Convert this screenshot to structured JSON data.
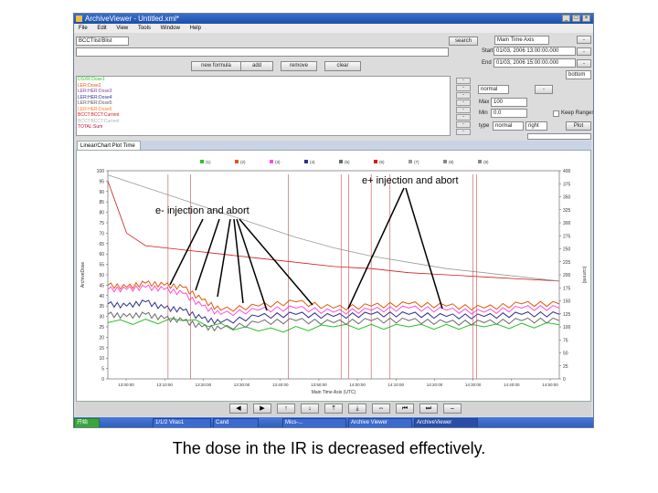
{
  "window": {
    "title": "ArchiveViewer - Untitled.xml*",
    "controls": [
      "_",
      "□",
      "×"
    ]
  },
  "menu": [
    "File",
    "Edit",
    "View",
    "Tools",
    "Window",
    "Help"
  ],
  "toolbar": {
    "pv_filter": "BCCTlist/Blist",
    "search_label": "search",
    "time_mode": "Main Time Axis",
    "start_label": "Start",
    "start_value": "01/03, 2006 13:00:00.000",
    "end_label": "End",
    "end_value": "01/03, 2006 15:00:00.000",
    "buttons": [
      "new formula",
      "add",
      "remove",
      "clear"
    ],
    "bottom_select": "bottom",
    "collapse_label": "-"
  },
  "pv_list": [
    {
      "name": "DSXR:Dose1",
      "color": "#2bbf2b"
    },
    {
      "name": "LER:Dose2",
      "color": "#e05a10"
    },
    {
      "name": "LER:HER:Dose3",
      "color": "#7a3fa0"
    },
    {
      "name": "LER:HER:Dose4",
      "color": "#2f2f8f"
    },
    {
      "name": "LER:HER:Dose5",
      "color": "#5a5a5a"
    },
    {
      "name": "LER:HER:Dose6",
      "color": "#ff7f2a"
    },
    {
      "name": "BCCT:BCCT:Current",
      "color": "#d11a1a"
    },
    {
      "name": "BCCT:BCCT:Current",
      "color": "#b0b0b0"
    },
    {
      "name": "TOTAL:Sum",
      "color": "#c01040"
    }
  ],
  "axis_panel": {
    "normal_select": "normal",
    "max_label": "Max",
    "max_value": "100",
    "min_label": "Min",
    "min_value": "0.0",
    "type_label": "type",
    "type_value": "normal",
    "side_value": "right",
    "keep_ranges_label": "Keep Ranges",
    "plot_button": "Plot"
  },
  "tab_label": "Linear/Chart Plot Time Plots",
  "annotations": {
    "eplus": "e+ injection and abort",
    "eminus": "e- injection and abort"
  },
  "caption": "The dose in the IR is decreased effectively.",
  "nav_icons": [
    "◀",
    "▶",
    "↑",
    "↓",
    "⤒",
    "⤓",
    "⇔",
    "⏮",
    "⏭",
    "–"
  ],
  "taskbar_items": [
    "开始",
    "1/1/2 Vilas1",
    "Cand",
    "Mics-...",
    "Archive Viewer",
    "ArchiveViewer"
  ],
  "chart_data": {
    "type": "line",
    "ylabel": "ArchiveDose",
    "y2label": "(current)",
    "xlabel": "Main Time Axis (UTC)",
    "ylim": [
      0,
      100
    ],
    "y2lim": [
      0,
      400
    ],
    "y_ticks": [
      "100",
      "95",
      "90",
      "85",
      "80",
      "75",
      "70",
      "65",
      "60",
      "55",
      "50",
      "45",
      "40",
      "35",
      "30",
      "25",
      "20",
      "15",
      "10",
      "5",
      "0"
    ],
    "y2_ticks": [
      "400",
      "375",
      "350",
      "325",
      "300",
      "275",
      "250",
      "225",
      "200",
      "175",
      "150",
      "125",
      "100",
      "75",
      "50",
      "25",
      "0"
    ],
    "x_ticks": [
      "13:00:00",
      "13:10:00",
      "13:20:00",
      "13:30:00",
      "13:40:00",
      "13:50:00",
      "14:00:00",
      "14:10:00",
      "14:20:00",
      "14:30:00",
      "14:40:00",
      "14:50:00"
    ],
    "x_range_min": [
      0,
      120
    ],
    "legend": [
      "(1)",
      "(2)",
      "(3)",
      "(4)",
      "(5)",
      "(6)",
      "(7)",
      "(8)",
      "(9)"
    ],
    "series": [
      {
        "color": "#2bbf2b",
        "x": [
          0,
          20,
          40,
          60,
          80,
          100,
          120
        ],
        "values": [
          27,
          28,
          23,
          25,
          25,
          25,
          26
        ]
      },
      {
        "color": "#e05a10",
        "x": [
          0,
          5,
          10,
          15,
          20,
          25,
          30,
          40,
          50,
          60,
          70,
          80,
          90,
          100,
          110,
          120
        ],
        "values": [
          45,
          44,
          46,
          45,
          44,
          38,
          33,
          35,
          37,
          34,
          35,
          36,
          35,
          34,
          36,
          36
        ]
      },
      {
        "color": "#ff4fd8",
        "x": [
          0,
          5,
          10,
          15,
          20,
          25,
          30,
          40,
          50,
          60,
          70,
          80,
          90,
          100,
          110,
          120
        ],
        "values": [
          43,
          43,
          44,
          43,
          41,
          35,
          31,
          33,
          34,
          32,
          33,
          34,
          33,
          32,
          34,
          34
        ]
      },
      {
        "color": "#2f2f8f",
        "x": [
          0,
          5,
          10,
          15,
          20,
          25,
          30,
          40,
          50,
          60,
          70,
          80,
          90,
          100,
          110,
          120
        ],
        "values": [
          36,
          35,
          37,
          34,
          33,
          29,
          27,
          30,
          31,
          30,
          31,
          31,
          30,
          30,
          31,
          31
        ]
      },
      {
        "color": "#6a6a6a",
        "x": [
          0,
          5,
          10,
          15,
          20,
          25,
          30,
          40,
          50,
          60,
          70,
          80,
          90,
          100,
          110,
          120
        ],
        "values": [
          31,
          30,
          31,
          29,
          28,
          25,
          24,
          27,
          28,
          27,
          28,
          28,
          27,
          27,
          28,
          28
        ]
      },
      {
        "color": "#d11a1a",
        "x": [
          0,
          5,
          10,
          20,
          30,
          40,
          50,
          60,
          70,
          80,
          90,
          100,
          110,
          120
        ],
        "values": [
          95,
          70,
          64,
          62,
          60,
          58,
          56,
          54,
          53,
          51,
          50,
          49,
          48,
          47
        ]
      },
      {
        "color": "#9a9a9a",
        "x": [
          0,
          10,
          20,
          30,
          40,
          50,
          60,
          70,
          80,
          90,
          100,
          110,
          120
        ],
        "values": [
          98,
          92,
          86,
          80,
          74,
          68,
          63,
          59,
          56,
          53,
          51,
          49,
          47
        ]
      }
    ]
  }
}
